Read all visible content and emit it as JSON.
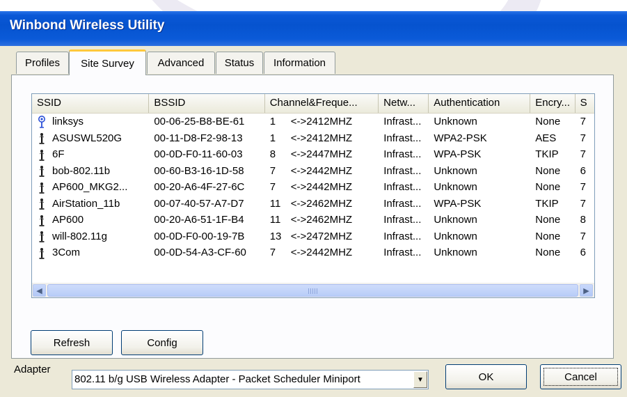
{
  "window": {
    "title": "Winbond Wireless Utility"
  },
  "tabs": [
    {
      "label": "Profiles",
      "active": false
    },
    {
      "label": "Site Survey",
      "active": true
    },
    {
      "label": "Advanced",
      "active": false
    },
    {
      "label": "Status",
      "active": false
    },
    {
      "label": "Information",
      "active": false
    }
  ],
  "site_survey": {
    "columns": [
      "SSID",
      "BSSID",
      "Channel&Freque...",
      "Netw...",
      "Authentication",
      "Encry...",
      "S"
    ],
    "rows": [
      {
        "icon": "connected-ap-icon",
        "ssid": "linksys",
        "bssid": "00-06-25-B8-BE-61",
        "channel": "1",
        "freq": "<->2412MHZ",
        "network": "Infrast...",
        "auth": "Unknown",
        "enc": "None",
        "signal": "7"
      },
      {
        "icon": "ap-icon",
        "ssid": "ASUSWL520G",
        "bssid": "00-11-D8-F2-98-13",
        "channel": "1",
        "freq": "<->2412MHZ",
        "network": "Infrast...",
        "auth": "WPA2-PSK",
        "enc": "AES",
        "signal": "7"
      },
      {
        "icon": "ap-icon",
        "ssid": "6F",
        "bssid": "00-0D-F0-11-60-03",
        "channel": "8",
        "freq": "<->2447MHZ",
        "network": "Infrast...",
        "auth": "WPA-PSK",
        "enc": "TKIP",
        "signal": "7"
      },
      {
        "icon": "ap-icon",
        "ssid": "bob-802.11b",
        "bssid": "00-60-B3-16-1D-58",
        "channel": "7",
        "freq": "<->2442MHZ",
        "network": "Infrast...",
        "auth": "Unknown",
        "enc": "None",
        "signal": "6"
      },
      {
        "icon": "ap-icon",
        "ssid": "AP600_MKG2...",
        "bssid": "00-20-A6-4F-27-6C",
        "channel": "7",
        "freq": "<->2442MHZ",
        "network": "Infrast...",
        "auth": "Unknown",
        "enc": "None",
        "signal": "7"
      },
      {
        "icon": "ap-icon",
        "ssid": "AirStation_11b",
        "bssid": "00-07-40-57-A7-D7",
        "channel": "11",
        "freq": "<->2462MHZ",
        "network": "Infrast...",
        "auth": "WPA-PSK",
        "enc": "TKIP",
        "signal": "7"
      },
      {
        "icon": "ap-icon",
        "ssid": "AP600",
        "bssid": "00-20-A6-51-1F-B4",
        "channel": "11",
        "freq": "<->2462MHZ",
        "network": "Infrast...",
        "auth": "Unknown",
        "enc": "None",
        "signal": "8"
      },
      {
        "icon": "ap-icon",
        "ssid": "will-802.11g",
        "bssid": "00-0D-F0-00-19-7B",
        "channel": "13",
        "freq": "<->2472MHZ",
        "network": "Infrast...",
        "auth": "Unknown",
        "enc": "None",
        "signal": "7"
      },
      {
        "icon": "ap-icon",
        "ssid": "3Com",
        "bssid": "00-0D-54-A3-CF-60",
        "channel": "7",
        "freq": "<->2442MHZ",
        "network": "Infrast...",
        "auth": "Unknown",
        "enc": "None",
        "signal": "6"
      }
    ],
    "scrollbar_grip": "III",
    "refresh_label": "Refresh",
    "config_label": "Config"
  },
  "footer": {
    "adapter_label": "Adapter",
    "adapter_value": "802.11 b/g USB Wireless Adapter - Packet Scheduler Miniport",
    "ok_label": "OK",
    "cancel_label": "Cancel"
  },
  "colors": {
    "title_bar": "#0653cf",
    "tab_highlight": "#ffc83c",
    "face": "#ece9d8"
  }
}
